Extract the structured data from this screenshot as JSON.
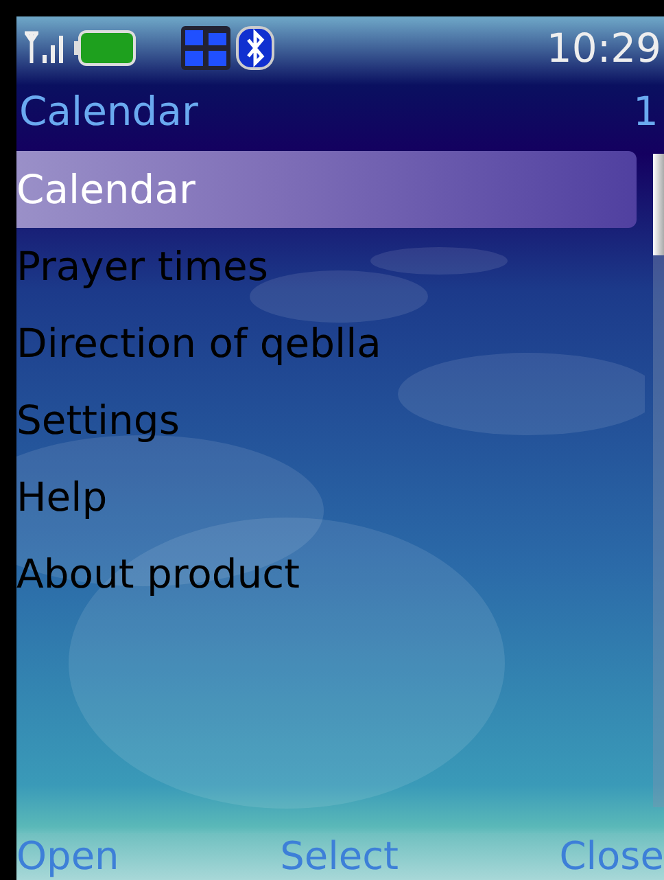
{
  "status_bar": {
    "time": "10:29"
  },
  "title_bar": {
    "title": "Calendar",
    "counter": "1"
  },
  "menu": [
    {
      "label": "Calendar",
      "selected": true
    },
    {
      "label": "Prayer times",
      "selected": false
    },
    {
      "label": "Direction of qeblla",
      "selected": false
    },
    {
      "label": "Settings",
      "selected": false
    },
    {
      "label": "Help",
      "selected": false
    },
    {
      "label": "About product",
      "selected": false
    }
  ],
  "softkeys": [
    "Open",
    "Select",
    "Close"
  ]
}
